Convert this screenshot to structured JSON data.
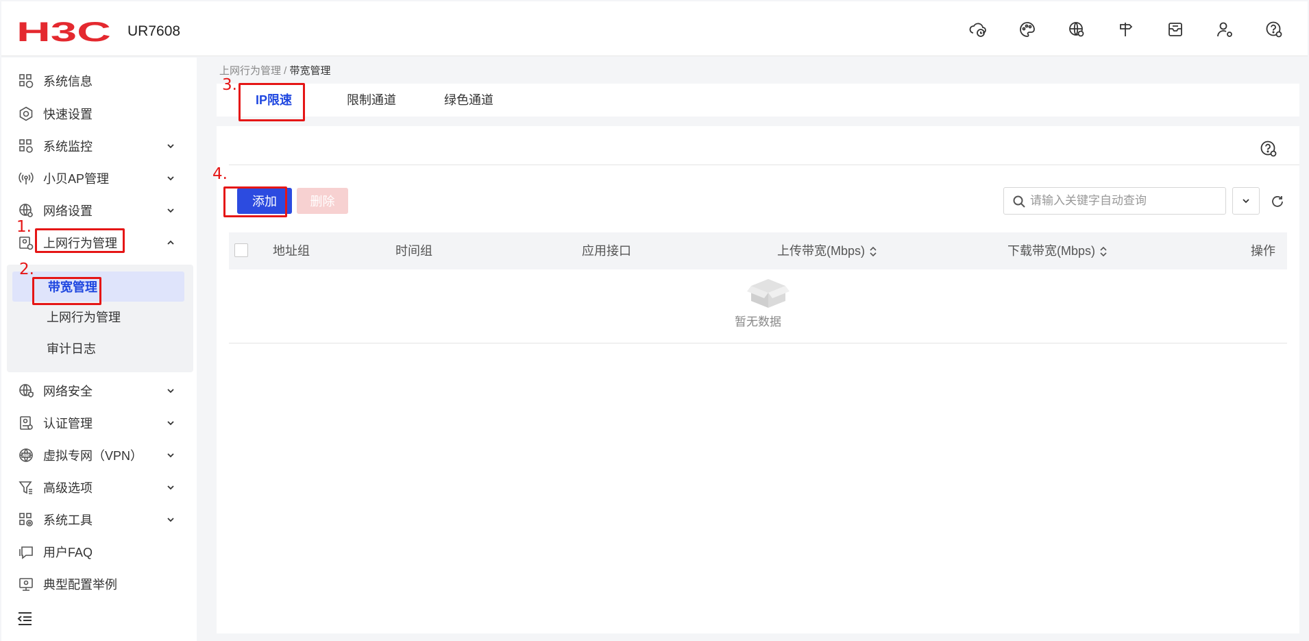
{
  "header": {
    "model": "UR7608",
    "icons": [
      "cloud-clock-icon",
      "palette-icon",
      "globe-settings-icon",
      "signpost-icon",
      "mailbox-icon",
      "user-settings-icon",
      "help-settings-icon"
    ]
  },
  "sidebar": {
    "items": [
      {
        "label": "系统信息",
        "icon": "system-info-icon"
      },
      {
        "label": "快速设置",
        "icon": "quick-settings-icon"
      },
      {
        "label": "系统监控",
        "icon": "system-monitor-icon"
      },
      {
        "label": "小贝AP管理",
        "icon": "ap-management-icon"
      },
      {
        "label": "网络设置",
        "icon": "network-settings-icon"
      },
      {
        "label": "上网行为管理",
        "icon": "behavior-management-icon"
      },
      {
        "label": "网络安全",
        "icon": "network-security-icon"
      },
      {
        "label": "认证管理",
        "icon": "auth-management-icon"
      },
      {
        "label": "虚拟专网（VPN）",
        "icon": "vpn-icon"
      },
      {
        "label": "高级选项",
        "icon": "advanced-options-icon"
      },
      {
        "label": "系统工具",
        "icon": "system-tools-icon"
      },
      {
        "label": "用户FAQ",
        "icon": "faq-icon"
      },
      {
        "label": "典型配置举例",
        "icon": "config-example-icon"
      }
    ],
    "submenu": [
      "带宽管理",
      "上网行为管理",
      "审计日志"
    ]
  },
  "breadcrumb": {
    "parent": "上网行为管理",
    "sep": " / ",
    "current": "带宽管理"
  },
  "tabs": [
    "IP限速",
    "限制通道",
    "绿色通道"
  ],
  "toolbar": {
    "add": "添加",
    "delete": "删除"
  },
  "search": {
    "placeholder": "请输入关键字自动查询"
  },
  "table": {
    "columns": [
      "地址组",
      "时间组",
      "应用接口",
      "上传带宽(Mbps)",
      "下载带宽(Mbps)",
      "操作"
    ],
    "empty": "暂无数据"
  },
  "annotations": [
    "1.",
    "2.",
    "3.",
    "4."
  ],
  "colors": {
    "accent": "#1f47e0",
    "brand_red": "#e4292f",
    "annotation": "#e51616"
  }
}
